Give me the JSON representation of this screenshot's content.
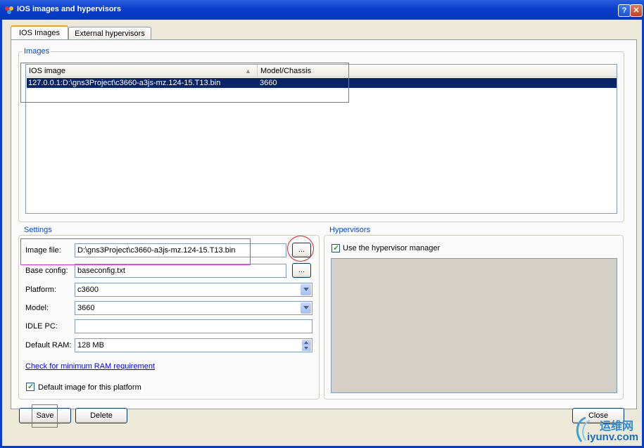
{
  "window": {
    "title": "IOS images and hypervisors",
    "help_glyph": "?",
    "close_glyph": "✕"
  },
  "tabs": [
    {
      "label": "IOS Images"
    },
    {
      "label": "External hypervisors"
    }
  ],
  "images": {
    "group_label": "Images",
    "columns": [
      "IOS image",
      "Model/Chassis"
    ],
    "rows": [
      {
        "image": "127.0.0.1:D:\\gns3Project\\c3660-a3js-mz.124-15.T13.bin",
        "model": "3660"
      }
    ]
  },
  "settings": {
    "group_label": "Settings",
    "image_file_label": "Image file:",
    "image_file_value": "D:\\gns3Project\\c3660-a3js-mz.124-15.T13.bin",
    "base_config_label": "Base config:",
    "base_config_value": "baseconfig.txt",
    "platform_label": "Platform:",
    "platform_value": "c3600",
    "model_label": "Model:",
    "model_value": "3660",
    "idle_pc_label": "IDLE PC:",
    "idle_pc_value": "",
    "default_ram_label": "Default RAM:",
    "default_ram_value": "128 MB",
    "browse_label": "...",
    "ram_link": "Check for minimum RAM requirement",
    "default_image_label": "Default image for this platform"
  },
  "hypervisors": {
    "group_label": "Hypervisors",
    "use_manager_label": "Use the hypervisor manager"
  },
  "buttons": {
    "save": "Save",
    "delete": "Delete",
    "close": "Close"
  },
  "watermark": {
    "text1": "运维网",
    "text2": "iyunv.com"
  },
  "colors": {
    "title_blue": "#0a3ec8",
    "selection": "#0a246a",
    "group_label": "#0046d5",
    "annotation_pink": "#d040d0",
    "annotation_red": "#e02020"
  }
}
